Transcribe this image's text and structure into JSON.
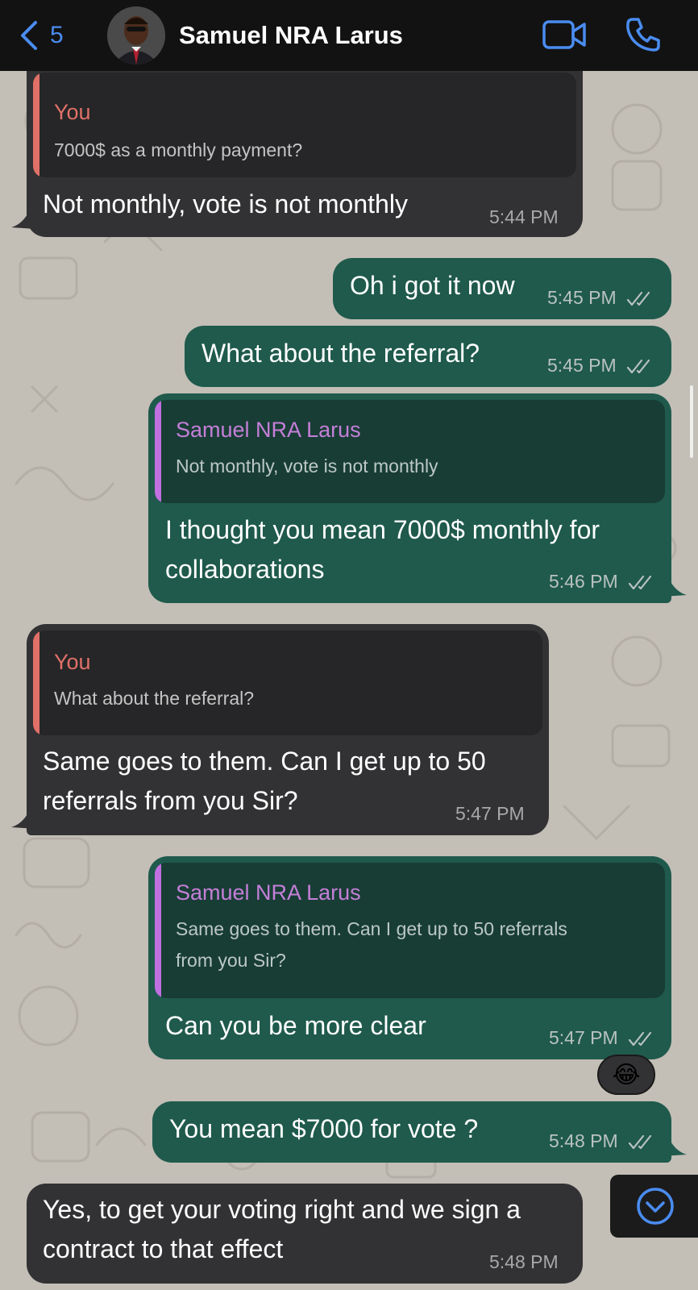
{
  "header": {
    "back_count": "5",
    "contact_name": "Samuel NRA Larus",
    "icons": [
      "chevron-left-icon",
      "video-call-icon",
      "phone-icon"
    ]
  },
  "messages": [
    {
      "direction": "incoming",
      "quote": {
        "author": "You",
        "text": "7000$ as a monthly payment?"
      },
      "text": "Not monthly, vote is not monthly",
      "time": "5:44 PM"
    },
    {
      "direction": "outgoing",
      "text": "Oh i got it now",
      "time": "5:45 PM"
    },
    {
      "direction": "outgoing",
      "text": "What about the referral?",
      "time": "5:45 PM"
    },
    {
      "direction": "outgoing",
      "quote": {
        "author": "Samuel NRA Larus",
        "text": "Not monthly, vote is not monthly"
      },
      "text_lines": [
        "I thought you mean 7000$ monthly for",
        "collaborations"
      ],
      "time": "5:46 PM"
    },
    {
      "direction": "incoming",
      "quote": {
        "author": "You",
        "text": "What about the referral?"
      },
      "text_lines": [
        "Same goes to them. Can I get up to 50",
        "referrals from you Sir?"
      ],
      "time": "5:47 PM"
    },
    {
      "direction": "outgoing",
      "quote": {
        "author": "Samuel NRA Larus",
        "text_lines": [
          "Same goes to them. Can I get up to 50 referrals",
          "from you Sir?"
        ]
      },
      "text": "Can you be more clear",
      "time": "5:47 PM",
      "reaction": "😂"
    },
    {
      "direction": "outgoing",
      "text": "You mean $7000 for vote ?",
      "time": "5:48 PM"
    },
    {
      "direction": "incoming",
      "text_lines": [
        "Yes, to get your voting right and we sign a",
        "contract to that effect"
      ],
      "time": "5:48 PM"
    }
  ],
  "colors": {
    "incoming_bubble": "#323234",
    "outgoing_bubble": "#1f5a4c",
    "accent_blue": "#4a8cf0",
    "quote_you": "#e07068",
    "quote_contact": "#c47fd8"
  }
}
